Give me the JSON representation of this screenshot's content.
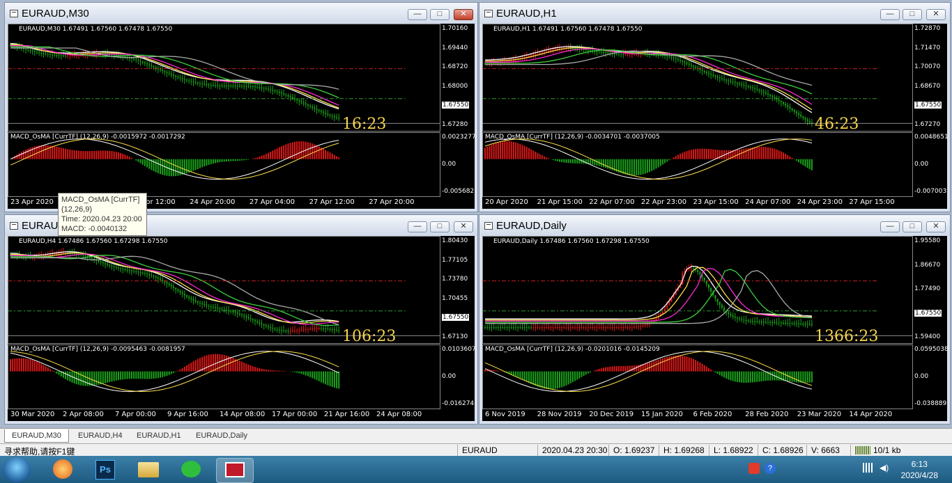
{
  "windows": [
    {
      "title": "EURAUD,M30",
      "info": "EURAUD,M30 1.67491 1.67560 1.67478 1.67550",
      "macd": "MACD_OsMA [CurrTF] (12,26,9) -0.0015972 -0.0017292",
      "prices": [
        "1.70160",
        "1.69440",
        "1.68720",
        "1.68000",
        "1.67550",
        "1.67280"
      ],
      "macd_scale": [
        "0.0023277",
        "0.00",
        "-0.005682"
      ],
      "xaxis": [
        "23 Apr 2020",
        "24 Apr 04:00",
        "24 Apr 12:00",
        "24 Apr 20:00",
        "27 Apr 04:00",
        "27 Apr 12:00",
        "27 Apr 20:00"
      ],
      "clock": "16:23"
    },
    {
      "title": "EURAUD,H1",
      "info": "EURAUD,H1 1.67491 1.67560 1.67478 1.67550",
      "macd": "MACD_OsMA [CurrTF] (12,26,9) -0.0034701 -0.0037005",
      "prices": [
        "1.72870",
        "1.71470",
        "1.70070",
        "1.68670",
        "1.67550",
        "1.67270"
      ],
      "macd_scale": [
        "0.0048651",
        "0.00",
        "-0.007003"
      ],
      "xaxis": [
        "20 Apr 2020",
        "21 Apr 15:00",
        "22 Apr 07:00",
        "22 Apr 23:00",
        "23 Apr 15:00",
        "24 Apr 07:00",
        "24 Apr 23:00",
        "27 Apr 15:00"
      ],
      "clock": "46:23"
    },
    {
      "title": "EURAUD,H4",
      "info": "EURAUD,H4 1.67486 1.67560 1.67298 1.67550",
      "macd": "MACD_OsMA [CurrTF] (12,26,9) -0.0095463 -0.0081957",
      "prices": [
        "1.80430",
        "1.77105",
        "1.73780",
        "1.70455",
        "1.67550",
        "1.67130"
      ],
      "macd_scale": [
        "0.0103607",
        "0.00",
        "-0.016274"
      ],
      "xaxis": [
        "30 Mar 2020",
        "2 Apr 08:00",
        "7 Apr 00:00",
        "9 Apr 16:00",
        "14 Apr 08:00",
        "17 Apr 00:00",
        "21 Apr 16:00",
        "24 Apr 08:00"
      ],
      "clock": "106:23"
    },
    {
      "title": "EURAUD,Daily",
      "info": "EURAUD,Daily 1.67486 1.67560 1.67298 1.67550",
      "macd": "MACD_OsMA [CurrTF] (12,26,9) -0.0201016 -0.0145209",
      "prices": [
        "1.95580",
        "1.86670",
        "1.77490",
        "1.67550",
        "1.59400"
      ],
      "macd_scale": [
        "0.0595038",
        "0.00",
        "-0.038889"
      ],
      "xaxis": [
        "6 Nov 2019",
        "28 Nov 2019",
        "20 Dec 2019",
        "15 Jan 2020",
        "6 Feb 2020",
        "28 Feb 2020",
        "23 Mar 2020",
        "14 Apr 2020"
      ],
      "clock": "1366:23"
    }
  ],
  "tooltip": {
    "line1": "MACD_OsMA [CurrTF]",
    "line2": "(12,26,9)",
    "line3": "Time: 2020.04.23 20:00",
    "line4": "MACD: -0.0040132"
  },
  "tabs": [
    "EURAUD,M30",
    "EURAUD,H4",
    "EURAUD,H1",
    "EURAUD,Daily"
  ],
  "status": {
    "help": "寻求帮助,请按F1键",
    "symbol": "EURAUD",
    "datetime": "2020.04.23 20:30",
    "open": "O: 1.69237",
    "high": "H: 1.69268",
    "low": "L: 1.68922",
    "close": "C: 1.68926",
    "volume": "V: 6663",
    "traffic": "10/1 kb"
  },
  "taskbar": {
    "time": "6:13",
    "date": "2020/4/28"
  },
  "colors": {
    "bull": "#e01818",
    "bear": "#1aa31a",
    "ma_fast": "#ffffff",
    "ma_yellow": "#ffe04a",
    "ma_magenta": "#ff2bd6",
    "ma_green": "#3ccf3c",
    "ma_gray": "#aaaaaa",
    "level_red": "#c82020",
    "level_green": "#2da02d"
  }
}
